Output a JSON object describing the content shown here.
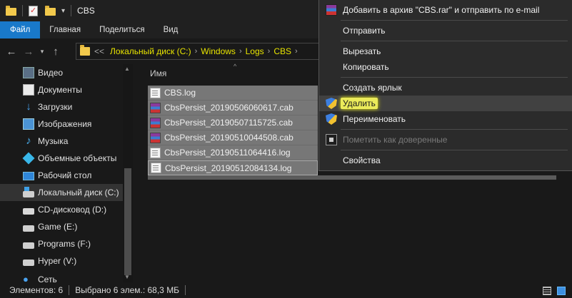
{
  "window": {
    "title": "CBS"
  },
  "ribbon": {
    "tabs": [
      "Файл",
      "Главная",
      "Поделиться",
      "Вид"
    ]
  },
  "address": {
    "lead": "<<",
    "crumbs": [
      "Локальный диск (C:)",
      "Windows",
      "Logs",
      "CBS"
    ]
  },
  "sidebar": {
    "items": [
      {
        "label": "Видео",
        "icon": "video-folder-icon"
      },
      {
        "label": "Документы",
        "icon": "documents-folder-icon"
      },
      {
        "label": "Загрузки",
        "icon": "downloads-folder-icon"
      },
      {
        "label": "Изображения",
        "icon": "pictures-folder-icon"
      },
      {
        "label": "Музыка",
        "icon": "music-folder-icon"
      },
      {
        "label": "Объемные объекты",
        "icon": "3d-objects-icon"
      },
      {
        "label": "Рабочий стол",
        "icon": "desktop-icon"
      },
      {
        "label": "Локальный диск (C:)",
        "icon": "system-drive-icon"
      },
      {
        "label": "CD-дисковод (D:)",
        "icon": "cd-drive-icon"
      },
      {
        "label": "Game (E:)",
        "icon": "drive-icon"
      },
      {
        "label": "Programs (F:)",
        "icon": "drive-icon"
      },
      {
        "label": "Hyper (V:)",
        "icon": "drive-icon"
      },
      {
        "label": "Сеть",
        "icon": "network-icon"
      }
    ]
  },
  "filelist": {
    "column_name": "Имя",
    "files": [
      {
        "name": "CBS.log",
        "icon": "log-file-icon"
      },
      {
        "name": "CbsPersist_20190506060617.cab",
        "icon": "cab-archive-icon"
      },
      {
        "name": "CbsPersist_20190507115725.cab",
        "icon": "cab-archive-icon"
      },
      {
        "name": "CbsPersist_20190510044508.cab",
        "icon": "cab-archive-icon"
      },
      {
        "name": "CbsPersist_20190511064416.log",
        "icon": "log-file-icon"
      },
      {
        "name": "CbsPersist_20190512084134.log",
        "icon": "log-file-icon"
      }
    ]
  },
  "context_menu": {
    "items": [
      {
        "label": "Добавить в архив \"CBS.rar\" и отправить по e-mail",
        "icon": "winrar-icon"
      },
      {
        "label": "Отправить"
      },
      {
        "label": "Вырезать"
      },
      {
        "label": "Копировать"
      },
      {
        "label": "Создать ярлык"
      },
      {
        "label": "Удалить",
        "icon": "uac-shield-icon",
        "highlighted": true
      },
      {
        "label": "Переименовать",
        "icon": "uac-shield-icon"
      },
      {
        "label": "Пометить как доверенные",
        "icon": "trust-icon",
        "disabled": true
      },
      {
        "label": "Свойства"
      }
    ]
  },
  "status": {
    "count": "Элементов: 6",
    "selected": "Выбрано 6 элем.: 68,3 МБ"
  },
  "colors": {
    "accent": "#1979ca",
    "highlight": "#ebeb5a",
    "breadcrumb": "#e8e400"
  }
}
